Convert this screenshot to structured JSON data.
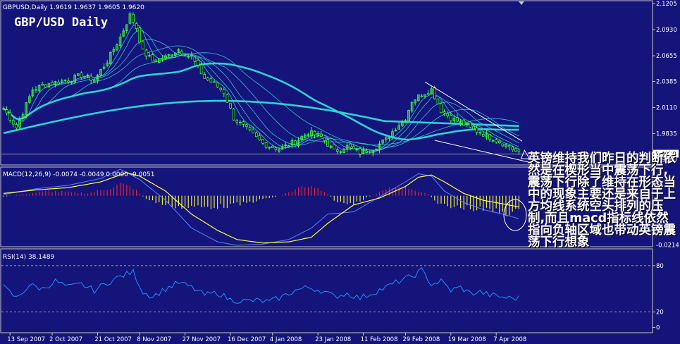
{
  "window": {
    "instrument_header": "GBPUSD,Daily  1.9619 1.9637 1.9605 1.9620",
    "chart_title": "GBP/USD  Daily"
  },
  "caption": {
    "text": "英镑维持我们昨日的判断依然是在楔形当中震荡下行,震荡下行除了维持在形态当中的现象主要还是来自于上方均线系统空头排列的压制,而且macd指标线依然指向负轴区域也带动英镑震荡下行想象"
  },
  "colors": {
    "background": "#14147a",
    "frame": "#c8c8c8",
    "candle": "#3cff3c",
    "ma_main": "#2fd2d2",
    "ma_thin": "#40dede",
    "macd_pos": "#ff2020",
    "macd_neg": "#ffff20",
    "signal_line": "#ffff40",
    "macd_line": "#6080ff",
    "rsi_line": "#2090ff",
    "wedge": "#ffffff",
    "current_price_line": "#c8c8c8"
  },
  "chart_data": [
    {
      "type": "candlestick",
      "name": "price",
      "title": "GBP/USD  Daily",
      "header": "GBPUSD,Daily  1.9619 1.9637 1.9605 1.9620",
      "ylim": [
        1.952,
        2.122
      ],
      "y_ticks": [
        {
          "value": 2.1205,
          "label": "2.1205"
        },
        {
          "value": 2.093,
          "label": "2.0930"
        },
        {
          "value": 2.0655,
          "label": "2.0655"
        },
        {
          "value": 2.0385,
          "label": "2.0385"
        },
        {
          "value": 2.011,
          "label": "2.0110"
        },
        {
          "value": 1.9835,
          "label": "1.9835"
        },
        {
          "value": 1.956,
          "label": "1.9560"
        }
      ],
      "current_price": {
        "value": 1.962,
        "label": "1.9620"
      },
      "bar_count": 160,
      "x_ticks": [
        {
          "bar": 2,
          "label": "13 Sep 2007"
        },
        {
          "bar": 15,
          "label": "2 Oct 2007"
        },
        {
          "bar": 29,
          "label": "21 Oct 2007"
        },
        {
          "bar": 42,
          "label": "8 Nov 2007"
        },
        {
          "bar": 56,
          "label": "27 Nov 2007"
        },
        {
          "bar": 70,
          "label": "16 Dec 2007"
        },
        {
          "bar": 83,
          "label": "4 Jan 2008"
        },
        {
          "bar": 97,
          "label": "23 Jan 2008"
        },
        {
          "bar": 111,
          "label": "11 Feb 2008"
        },
        {
          "bar": 124,
          "label": "29 Feb 2008"
        },
        {
          "bar": 138,
          "label": "19 Mar 2008"
        },
        {
          "bar": 152,
          "label": "7 Apr 2008"
        }
      ],
      "close_anchors": [
        [
          0,
          2.01
        ],
        [
          4,
          1.99
        ],
        [
          9,
          2.03
        ],
        [
          14,
          2.036
        ],
        [
          20,
          2.04
        ],
        [
          24,
          2.045
        ],
        [
          28,
          2.04
        ],
        [
          32,
          2.06
        ],
        [
          36,
          2.085
        ],
        [
          39,
          2.108
        ],
        [
          41,
          2.095
        ],
        [
          43,
          2.07
        ],
        [
          46,
          2.06
        ],
        [
          50,
          2.064
        ],
        [
          54,
          2.072
        ],
        [
          58,
          2.064
        ],
        [
          62,
          2.042
        ],
        [
          65,
          2.036
        ],
        [
          68,
          2.027
        ],
        [
          71,
          2.0
        ],
        [
          75,
          1.988
        ],
        [
          80,
          1.973
        ],
        [
          85,
          1.967
        ],
        [
          90,
          1.975
        ],
        [
          94,
          1.985
        ],
        [
          98,
          1.98
        ],
        [
          102,
          1.965
        ],
        [
          106,
          1.97
        ],
        [
          110,
          1.963
        ],
        [
          114,
          1.968
        ],
        [
          118,
          1.977
        ],
        [
          121,
          1.99
        ],
        [
          124,
          2.0
        ],
        [
          126,
          2.018
        ],
        [
          129,
          2.025
        ],
        [
          132,
          2.03
        ],
        [
          135,
          2.008
        ],
        [
          138,
          2.0
        ],
        [
          141,
          1.995
        ],
        [
          144,
          1.989
        ],
        [
          147,
          1.985
        ],
        [
          150,
          1.98
        ],
        [
          153,
          1.975
        ],
        [
          156,
          1.97
        ],
        [
          159,
          1.962
        ]
      ],
      "wedge_lines": [
        {
          "from": {
            "bar": 130,
            "value": 2.038
          },
          "to": {
            "bar": 160,
            "value": 1.9755
          }
        },
        {
          "from": {
            "bar": 133,
            "value": 1.9765
          },
          "to": {
            "bar": 162,
            "value": 1.9535
          }
        }
      ]
    },
    {
      "type": "histogram",
      "name": "macd",
      "header": "MACD(12,26,9) -0.0074 -0.0049 0.0000 -0.0051",
      "ylim": [
        -0.0215,
        0.0118
      ],
      "y_ticks": [
        {
          "value": -0.0214,
          "label": "-0.0214"
        }
      ],
      "histogram_anchors": [
        [
          0,
          -0.0005
        ],
        [
          8,
          0.001
        ],
        [
          14,
          0.002
        ],
        [
          20,
          0.0015
        ],
        [
          26,
          0.001
        ],
        [
          32,
          0.003
        ],
        [
          36,
          0.005
        ],
        [
          40,
          0.0035
        ],
        [
          44,
          -0.0015
        ],
        [
          50,
          -0.004
        ],
        [
          56,
          -0.005
        ],
        [
          62,
          -0.005
        ],
        [
          68,
          -0.0045
        ],
        [
          74,
          -0.0035
        ],
        [
          80,
          -0.0015
        ],
        [
          84,
          -0.0005
        ],
        [
          88,
          0.0015
        ],
        [
          92,
          0.004
        ],
        [
          95,
          0.0045
        ],
        [
          99,
          0.002
        ],
        [
          103,
          -0.003
        ],
        [
          107,
          -0.0035
        ],
        [
          111,
          -0.0015
        ],
        [
          115,
          0.001
        ],
        [
          119,
          0.003
        ],
        [
          122,
          0.0042
        ],
        [
          125,
          0.0035
        ],
        [
          128,
          0.002
        ],
        [
          131,
          0.0005
        ],
        [
          134,
          -0.0035
        ],
        [
          138,
          -0.005
        ],
        [
          142,
          -0.005
        ],
        [
          146,
          -0.006
        ],
        [
          150,
          -0.0065
        ],
        [
          154,
          -0.007
        ],
        [
          159,
          -0.0074
        ]
      ],
      "signal_anchors": [
        [
          0,
          0.001
        ],
        [
          10,
          0.0025
        ],
        [
          20,
          0.0035
        ],
        [
          30,
          0.006
        ],
        [
          38,
          0.01
        ],
        [
          42,
          0.0085
        ],
        [
          50,
          0.002
        ],
        [
          58,
          -0.008
        ],
        [
          66,
          -0.015
        ],
        [
          72,
          -0.019
        ],
        [
          80,
          -0.0205
        ],
        [
          88,
          -0.02
        ],
        [
          95,
          -0.018
        ],
        [
          100,
          -0.012
        ],
        [
          108,
          -0.004
        ],
        [
          116,
          -0.001
        ],
        [
          124,
          0.004
        ],
        [
          128,
          0.008
        ],
        [
          132,
          0.009
        ],
        [
          136,
          0.006
        ],
        [
          142,
          0.001
        ],
        [
          148,
          -0.002
        ],
        [
          154,
          -0.0035
        ],
        [
          159,
          -0.0049
        ]
      ],
      "macd_anchors": [
        [
          0,
          0.0005
        ],
        [
          10,
          0.003
        ],
        [
          20,
          0.0045
        ],
        [
          30,
          0.0075
        ],
        [
          36,
          0.0115
        ],
        [
          42,
          0.007
        ],
        [
          50,
          -0.002
        ],
        [
          58,
          -0.014
        ],
        [
          66,
          -0.02
        ],
        [
          72,
          -0.0215
        ],
        [
          80,
          -0.021
        ],
        [
          88,
          -0.019
        ],
        [
          95,
          -0.014
        ],
        [
          100,
          -0.008
        ],
        [
          108,
          -0.007
        ],
        [
          116,
          -0.0005
        ],
        [
          124,
          0.006
        ],
        [
          128,
          0.0095
        ],
        [
          132,
          0.0085
        ],
        [
          136,
          0.002
        ],
        [
          142,
          -0.003
        ],
        [
          148,
          -0.006
        ],
        [
          154,
          -0.008
        ],
        [
          159,
          -0.01
        ]
      ]
    },
    {
      "type": "line",
      "name": "rsi",
      "header": "RSI(14) 38.1489",
      "ylim": [
        -5,
        100
      ],
      "y_ticks": [
        {
          "value": 80,
          "label": "80"
        },
        {
          "value": 20,
          "label": "20"
        },
        {
          "value": 0,
          "label": "0"
        }
      ],
      "guide_levels": [
        80,
        20
      ],
      "rsi_anchors": [
        [
          0,
          52
        ],
        [
          4,
          38
        ],
        [
          8,
          55
        ],
        [
          12,
          50
        ],
        [
          16,
          60
        ],
        [
          20,
          52
        ],
        [
          24,
          56
        ],
        [
          28,
          48
        ],
        [
          32,
          58
        ],
        [
          36,
          66
        ],
        [
          40,
          72
        ],
        [
          43,
          46
        ],
        [
          46,
          40
        ],
        [
          50,
          50
        ],
        [
          54,
          58
        ],
        [
          58,
          52
        ],
        [
          62,
          42
        ],
        [
          66,
          45
        ],
        [
          70,
          36
        ],
        [
          74,
          34
        ],
        [
          78,
          35
        ],
        [
          82,
          33
        ],
        [
          86,
          40
        ],
        [
          90,
          48
        ],
        [
          94,
          52
        ],
        [
          98,
          48
        ],
        [
          102,
          40
        ],
        [
          106,
          44
        ],
        [
          110,
          38
        ],
        [
          114,
          45
        ],
        [
          118,
          52
        ],
        [
          122,
          60
        ],
        [
          126,
          66
        ],
        [
          129,
          74
        ],
        [
          132,
          56
        ],
        [
          135,
          60
        ],
        [
          138,
          48
        ],
        [
          141,
          52
        ],
        [
          144,
          44
        ],
        [
          147,
          46
        ],
        [
          150,
          42
        ],
        [
          153,
          40
        ],
        [
          156,
          38
        ],
        [
          159,
          38
        ]
      ]
    }
  ]
}
